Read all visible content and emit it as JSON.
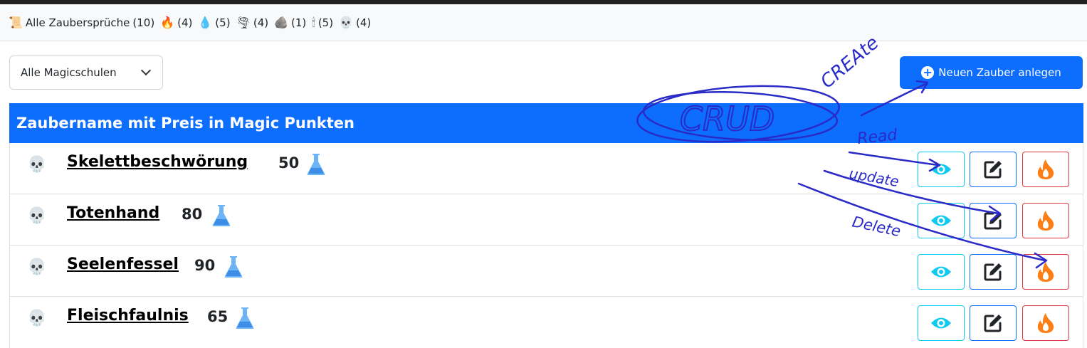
{
  "filters": [
    {
      "icon": "📜",
      "label": "Alle Zaubersprüche",
      "count": "(10)"
    },
    {
      "icon": "🔥",
      "label": "",
      "count": "(4)"
    },
    {
      "icon": "💧",
      "label": "",
      "count": "(5)"
    },
    {
      "icon": "🌪",
      "label": "",
      "count": "(4)"
    },
    {
      "icon": "🪨",
      "label": "",
      "count": "(1)"
    },
    {
      "icon": "🕯",
      "label": "",
      "count": "(5)"
    },
    {
      "icon": "💀",
      "label": "",
      "count": "(4)"
    }
  ],
  "school_select": {
    "value": "Alle Magicschulen"
  },
  "new_button": {
    "label": "Neuen Zauber anlegen"
  },
  "table": {
    "header": "Zaubername mit Preis in Magic Punkten",
    "rows": [
      {
        "icon": "💀",
        "name": "Skelettbeschwörung",
        "price": "50"
      },
      {
        "icon": "💀",
        "name": "Totenhand",
        "price": "80"
      },
      {
        "icon": "💀",
        "name": "Seelenfessel",
        "price": "90"
      },
      {
        "icon": "💀",
        "name": "Fleischfaulnis",
        "price": "65"
      }
    ]
  },
  "annotations": {
    "crud": "CRUD",
    "create": "CREAte",
    "read": "Read",
    "update": "update",
    "delete": "Delete"
  },
  "colors": {
    "primary": "#0d6efd",
    "info": "#0dcaf0",
    "danger": "#dc3545",
    "flame": "#fd7e14",
    "flask": "#6cb4f5",
    "annotation_ink": "#2a2ac8"
  },
  "icons": {
    "view": "eye-icon",
    "edit": "pencil-square-icon",
    "delete": "fire-icon",
    "price": "flask-icon"
  }
}
